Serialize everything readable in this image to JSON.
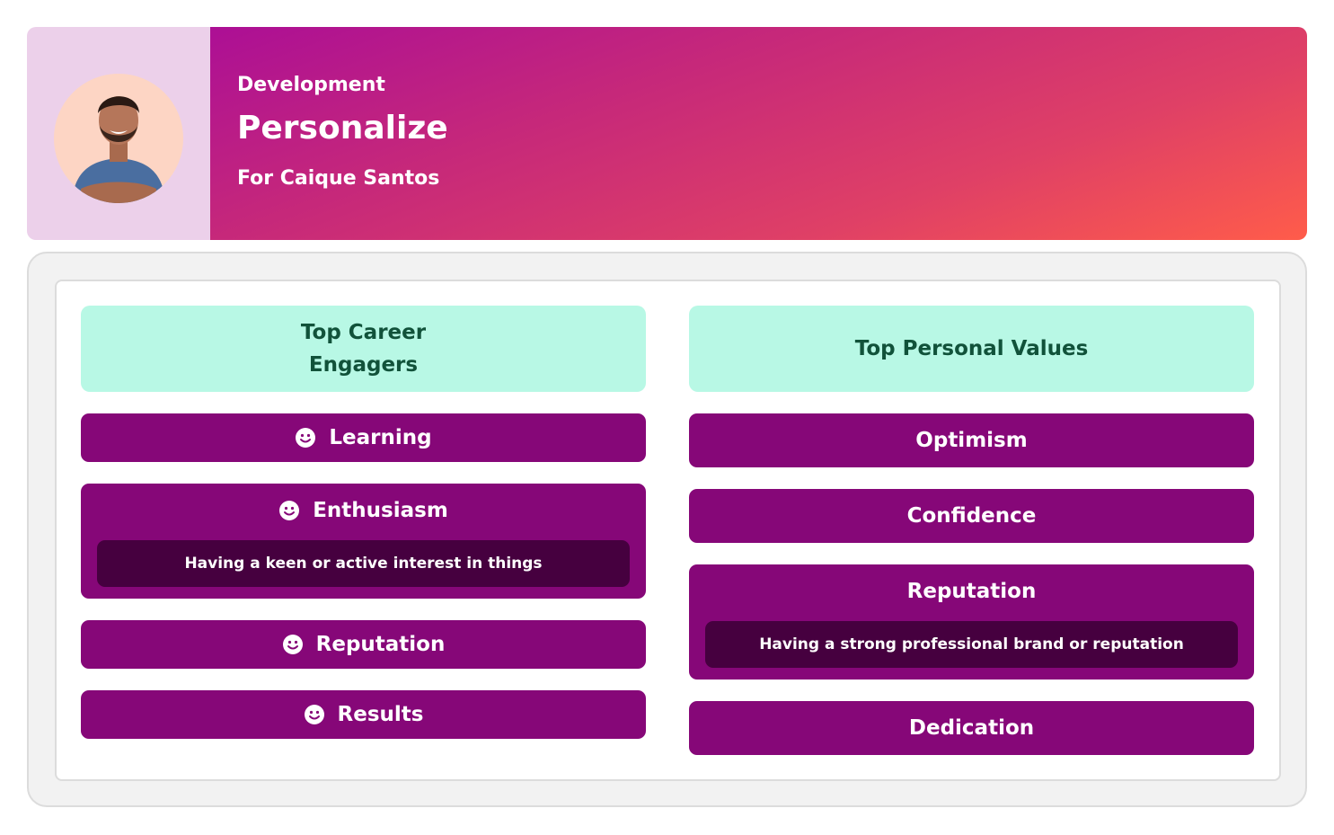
{
  "header": {
    "avatar_alt": "Caique Santos",
    "subtitle": "Development",
    "title": "Personalize",
    "for_line": "For Caique Santos"
  },
  "career": {
    "heading": "Top Career Engagers",
    "items": [
      {
        "label": "Learning",
        "icon": "smile-icon"
      },
      {
        "label": "Enthusiasm",
        "icon": "smile-icon",
        "description": "Having a keen or active interest in things"
      },
      {
        "label": "Reputation",
        "icon": "smile-icon"
      },
      {
        "label": "Results",
        "icon": "smile-icon"
      }
    ]
  },
  "values": {
    "heading": "Top Personal Values",
    "items": [
      {
        "label": "Optimism"
      },
      {
        "label": "Confidence"
      },
      {
        "label": "Reputation",
        "description": "Having a strong professional brand or reputation"
      },
      {
        "label": "Dedication"
      }
    ]
  },
  "colors": {
    "item_bg": "#860778",
    "desc_bg": "#46003f",
    "header_bg": "#b8f8e5",
    "header_text": "#11523a"
  }
}
